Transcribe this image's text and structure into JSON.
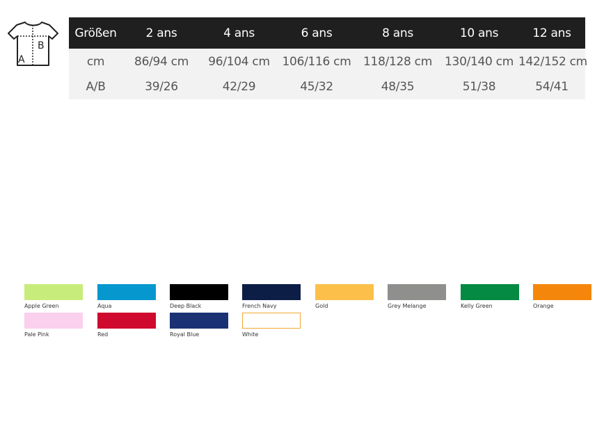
{
  "size_table": {
    "headers": [
      "Größen",
      "2 ans",
      "4 ans",
      "6 ans",
      "8 ans",
      "10 ans",
      "12 ans"
    ],
    "rows": [
      [
        "cm",
        "86/94 cm",
        "96/104 cm",
        "106/116 cm",
        "118/128 cm",
        "130/140 cm",
        "142/152 cm"
      ],
      [
        "A/B",
        "39/26",
        "42/29",
        "45/32",
        "48/35",
        "51/38",
        "54/41"
      ]
    ]
  },
  "shirt_diagram": {
    "label_a": "A",
    "label_b": "B"
  },
  "colors": [
    {
      "name": "Apple Green",
      "hex": "#c8ec7c"
    },
    {
      "name": "Aqua",
      "hex": "#0797cf"
    },
    {
      "name": "Deep Black",
      "hex": "#000000"
    },
    {
      "name": "French Navy",
      "hex": "#0c1e46"
    },
    {
      "name": "Gold",
      "hex": "#fcc04a"
    },
    {
      "name": "Grey Melange",
      "hex": "#8f8f8d"
    },
    {
      "name": "Kelly Green",
      "hex": "#048a42"
    },
    {
      "name": "Orange",
      "hex": "#f4870b"
    },
    {
      "name": "Pale Pink",
      "hex": "#fbcfee"
    },
    {
      "name": "Red",
      "hex": "#cf0a2e"
    },
    {
      "name": "Royal Blue",
      "hex": "#1a3274"
    },
    {
      "name": "White",
      "hex": "#ffffff",
      "border": "#f0a830"
    }
  ]
}
